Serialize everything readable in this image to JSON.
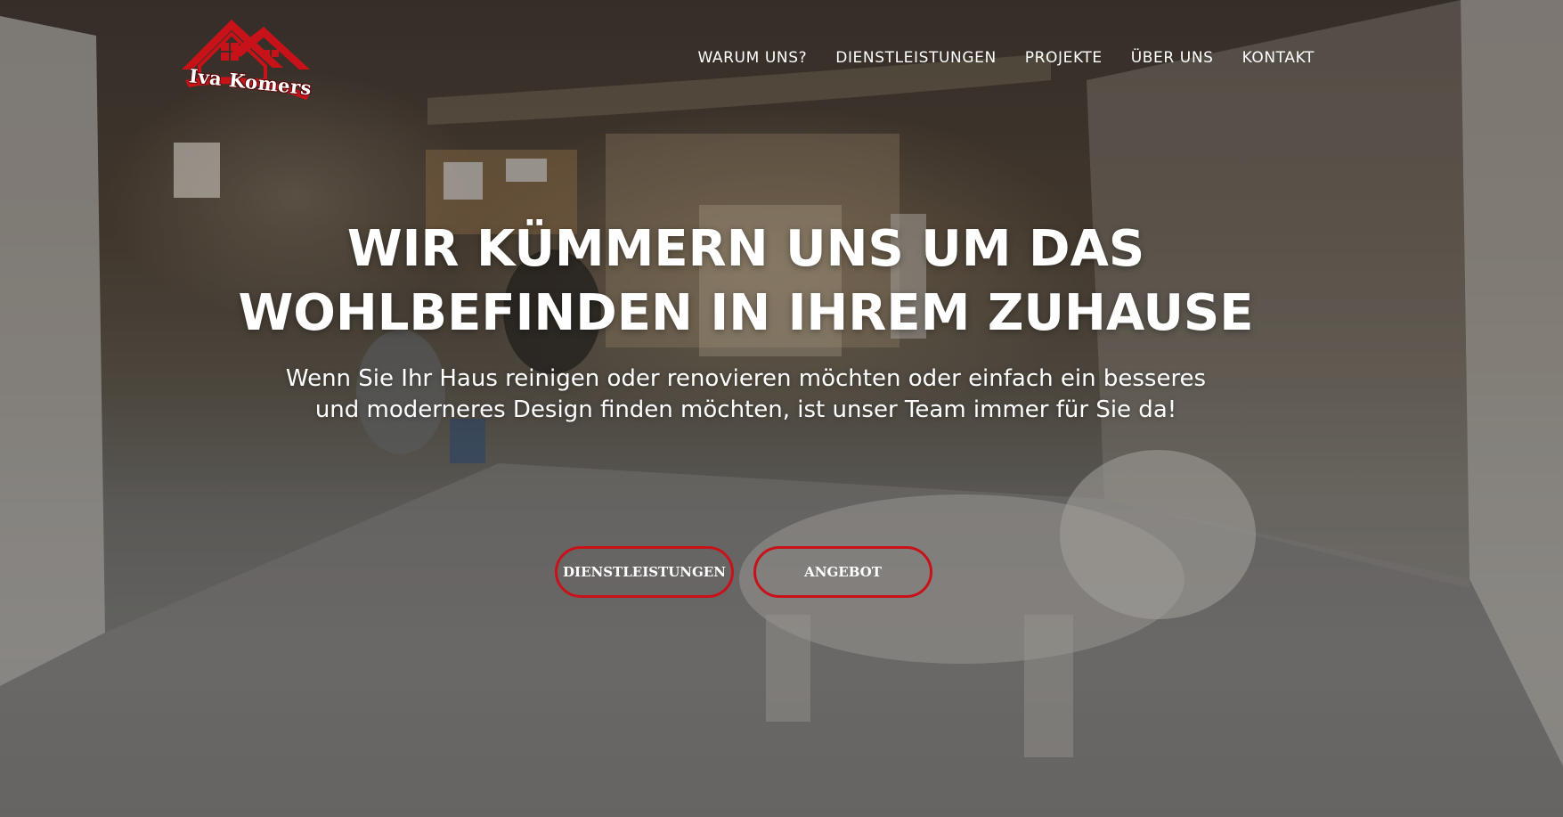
{
  "brand": {
    "logo_text": "Iva Komers",
    "accent_color": "#c8121a"
  },
  "nav": {
    "items": [
      "WARUM UNS?",
      "DIENSTLEISTUNGEN",
      "PROJEKTE",
      "ÜBER UNS",
      "KONTAKT"
    ]
  },
  "hero": {
    "headline_line1": "WIR KÜMMERN UNS UM DAS",
    "headline_line2": "WOHLBEFINDEN IN IHREM ZUHAUSE",
    "subhead": "Wenn Sie Ihr Haus reinigen oder renovieren möchten oder einfach ein besseres und moderneres Design finden möchten, ist unser Team immer für Sie da!",
    "buttons": {
      "services_label": "DIENSTLEISTUNGEN",
      "offer_label": "ANGEBOT"
    },
    "background": "renovation-room-with-dog-photo"
  }
}
